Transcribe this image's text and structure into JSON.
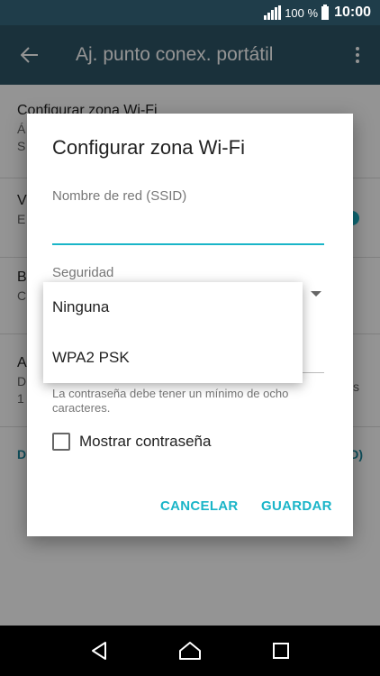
{
  "status_bar": {
    "battery_pct": "100 %",
    "time": "10:00",
    "icons": [
      "signal-icon",
      "battery-icon"
    ]
  },
  "app_bar": {
    "title": "Aj. punto conex. portátil",
    "icons": [
      "back-arrow-icon",
      "more-vert-icon"
    ]
  },
  "settings_list": {
    "rows": [
      {
        "title": "Configurar zona Wi-Fi",
        "subtitle": "Á",
        "subtitle2": "S"
      },
      {
        "title": "V",
        "subtitle": "E"
      },
      {
        "title": "B",
        "subtitle": "C"
      },
      {
        "title": "A",
        "subtitle": "D",
        "subtitle2": "1",
        "trailing": "s"
      }
    ],
    "link_left": "D",
    "link_right": "D)"
  },
  "dialog": {
    "title": "Configurar zona Wi-Fi",
    "ssid_label": "Nombre de red (SSID)",
    "ssid_value": "",
    "security_label": "Seguridad",
    "password_hint": "La contraseña debe tener un mínimo de ocho caracteres.",
    "show_password_label": "Mostrar contraseña",
    "show_password_checked": false,
    "cancel_label": "CANCELAR",
    "save_label": "GUARDAR"
  },
  "security_dropdown": {
    "options": [
      "Ninguna",
      "WPA2 PSK"
    ]
  },
  "nav_bar": {
    "icons": [
      "back-triangle-icon",
      "home-icon",
      "recents-icon"
    ]
  },
  "colors": {
    "accent": "#1ab5c8",
    "app_bar": "#2e5566",
    "status_bar": "#1f3d4a"
  }
}
